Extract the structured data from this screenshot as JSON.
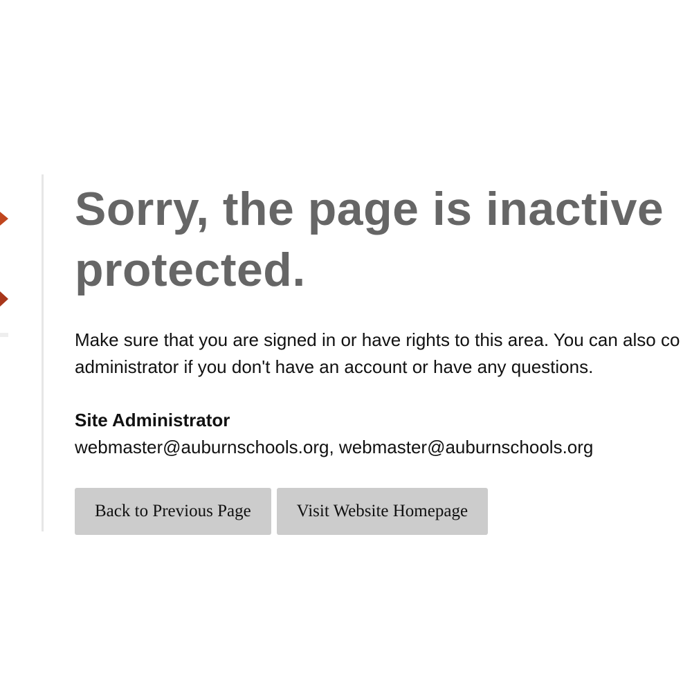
{
  "heading": {
    "line1": "Sorry, the page is inactive",
    "line2": "protected."
  },
  "message": {
    "line1": "Make sure that you are signed in or have rights to this area. You can also co",
    "line2": "administrator if you don't have an account or have any questions."
  },
  "admin": {
    "title": "Site Administrator",
    "emails": "webmaster@auburnschools.org, webmaster@auburnschools.org"
  },
  "buttons": {
    "back_label": "Back to Previous Page",
    "home_label": "Visit Website Homepage"
  },
  "colors": {
    "heading": "#666666",
    "button_bg": "#cccccc",
    "divider": "#e6e6e6",
    "logo_accent": "#c0461e"
  },
  "icons": {
    "logo": "school-logo-icon"
  }
}
